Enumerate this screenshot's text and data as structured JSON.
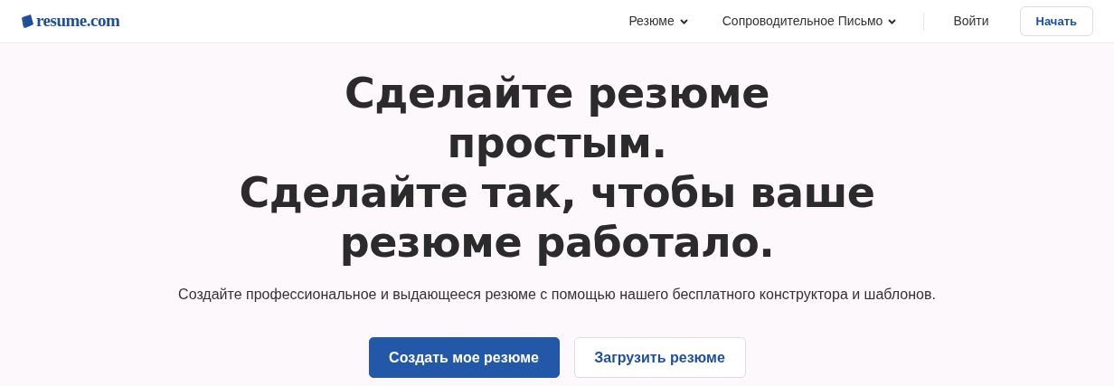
{
  "header": {
    "logo": "resume.com",
    "nav": [
      {
        "label": "Резюме",
        "dropdown": true
      },
      {
        "label": "Сопроводительное Письмо",
        "dropdown": true
      }
    ],
    "login": "Войти",
    "start_button": "Начать"
  },
  "hero": {
    "headline_lines": [
      "Сделайте резюме",
      "простым.",
      "Сделайте так, чтобы ваше",
      "резюме работало."
    ],
    "subtitle": "Создайте профессиональное и выдающееся резюме с помощью нашего бесплатного конструктора и шаблонов.",
    "buttons": [
      {
        "label": "Создать мое резюме",
        "kind": "primary"
      },
      {
        "label": "Загрузить резюме",
        "kind": "secondary"
      }
    ]
  }
}
